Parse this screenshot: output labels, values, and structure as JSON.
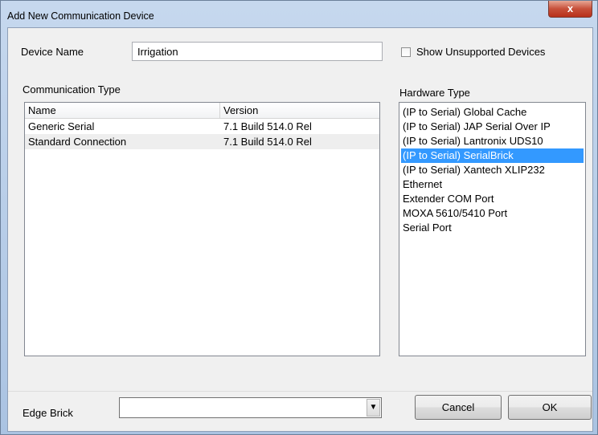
{
  "window": {
    "title": "Add New Communication Device",
    "close_glyph": "x"
  },
  "device_name": {
    "label": "Device Name",
    "value": "Irrigation"
  },
  "show_unsupported": {
    "label": "Show Unsupported Devices",
    "checked": false
  },
  "communication_type": {
    "label": "Communication Type",
    "columns": [
      "Name",
      "Version"
    ],
    "rows": [
      {
        "name": "Generic Serial",
        "version": "7.1 Build 514.0 Rel"
      },
      {
        "name": "Standard Connection",
        "version": "7.1 Build 514.0 Rel"
      }
    ]
  },
  "hardware_type": {
    "label": "Hardware Type",
    "items": [
      "(IP to Serial) Global Cache",
      "(IP to Serial) JAP Serial Over IP",
      "(IP to Serial) Lantronix UDS10",
      "(IP to Serial) SerialBrick",
      "(IP to Serial) Xantech XLIP232",
      "Ethernet",
      "Extender COM Port",
      "MOXA 5610/5410 Port",
      "Serial Port"
    ],
    "selected_index": 3,
    "selection_color": "#3399ff"
  },
  "edge_brick": {
    "label": "Edge Brick",
    "value": ""
  },
  "buttons": {
    "cancel": "Cancel",
    "ok": "OK"
  }
}
